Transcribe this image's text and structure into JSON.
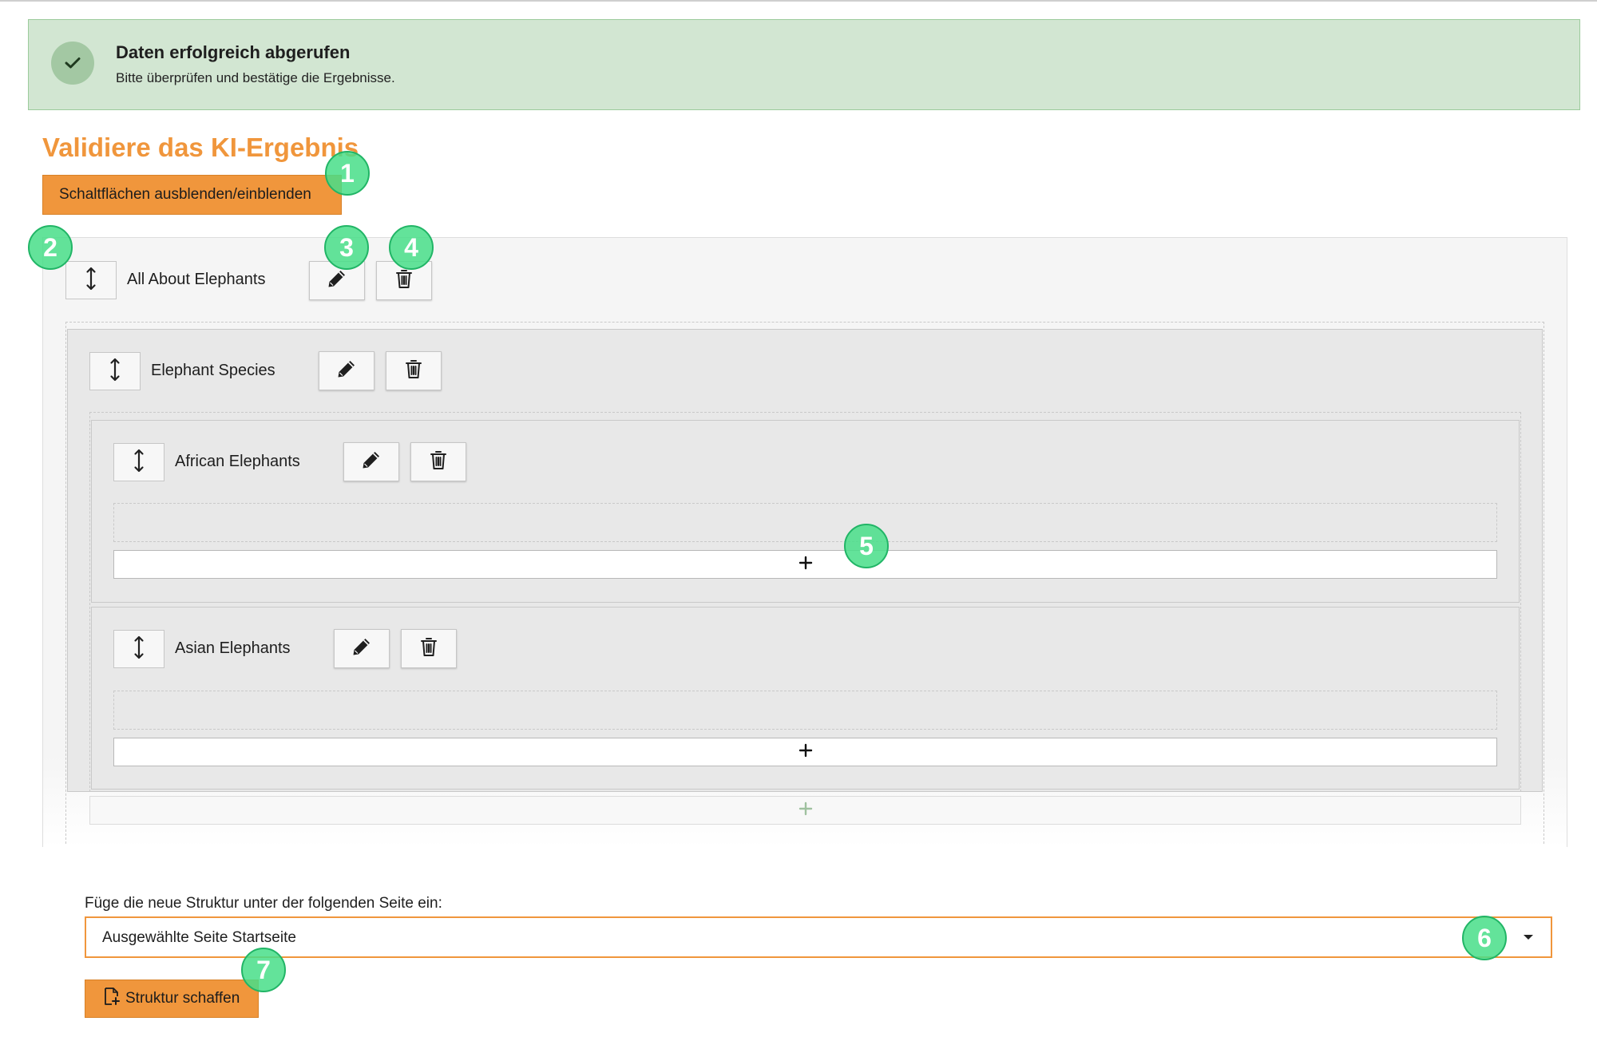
{
  "alert": {
    "title": "Daten erfolgreich abgerufen",
    "message": "Bitte überprüfen und bestätige die Ergebnisse.",
    "icon": "checkmark-icon"
  },
  "heading": "Validiere das KI-Ergebnis",
  "toggle_button": "Schaltflächen ausblenden/einblenden",
  "tree": {
    "root": {
      "label": "All About Elephants"
    },
    "level1": {
      "label": "Elephant Species"
    },
    "children": [
      {
        "label": "African Elephants"
      },
      {
        "label": "Asian Elephants"
      }
    ]
  },
  "icons": {
    "move": "move-vertical-icon",
    "edit": "pencil-icon",
    "delete": "trash-icon",
    "add": "plus-icon",
    "create": "page-add-icon"
  },
  "insert_label": "Füge die neue Struktur unter der folgenden Seite ein:",
  "page_select": {
    "selected": "Ausgewählte Seite Startseite"
  },
  "create_button": "Struktur schaffen",
  "callouts": [
    "1",
    "2",
    "3",
    "4",
    "5",
    "6",
    "7"
  ],
  "colors": {
    "accent": "#f0963c",
    "success_bg": "#d2e6d2",
    "callout": "#48de88"
  }
}
